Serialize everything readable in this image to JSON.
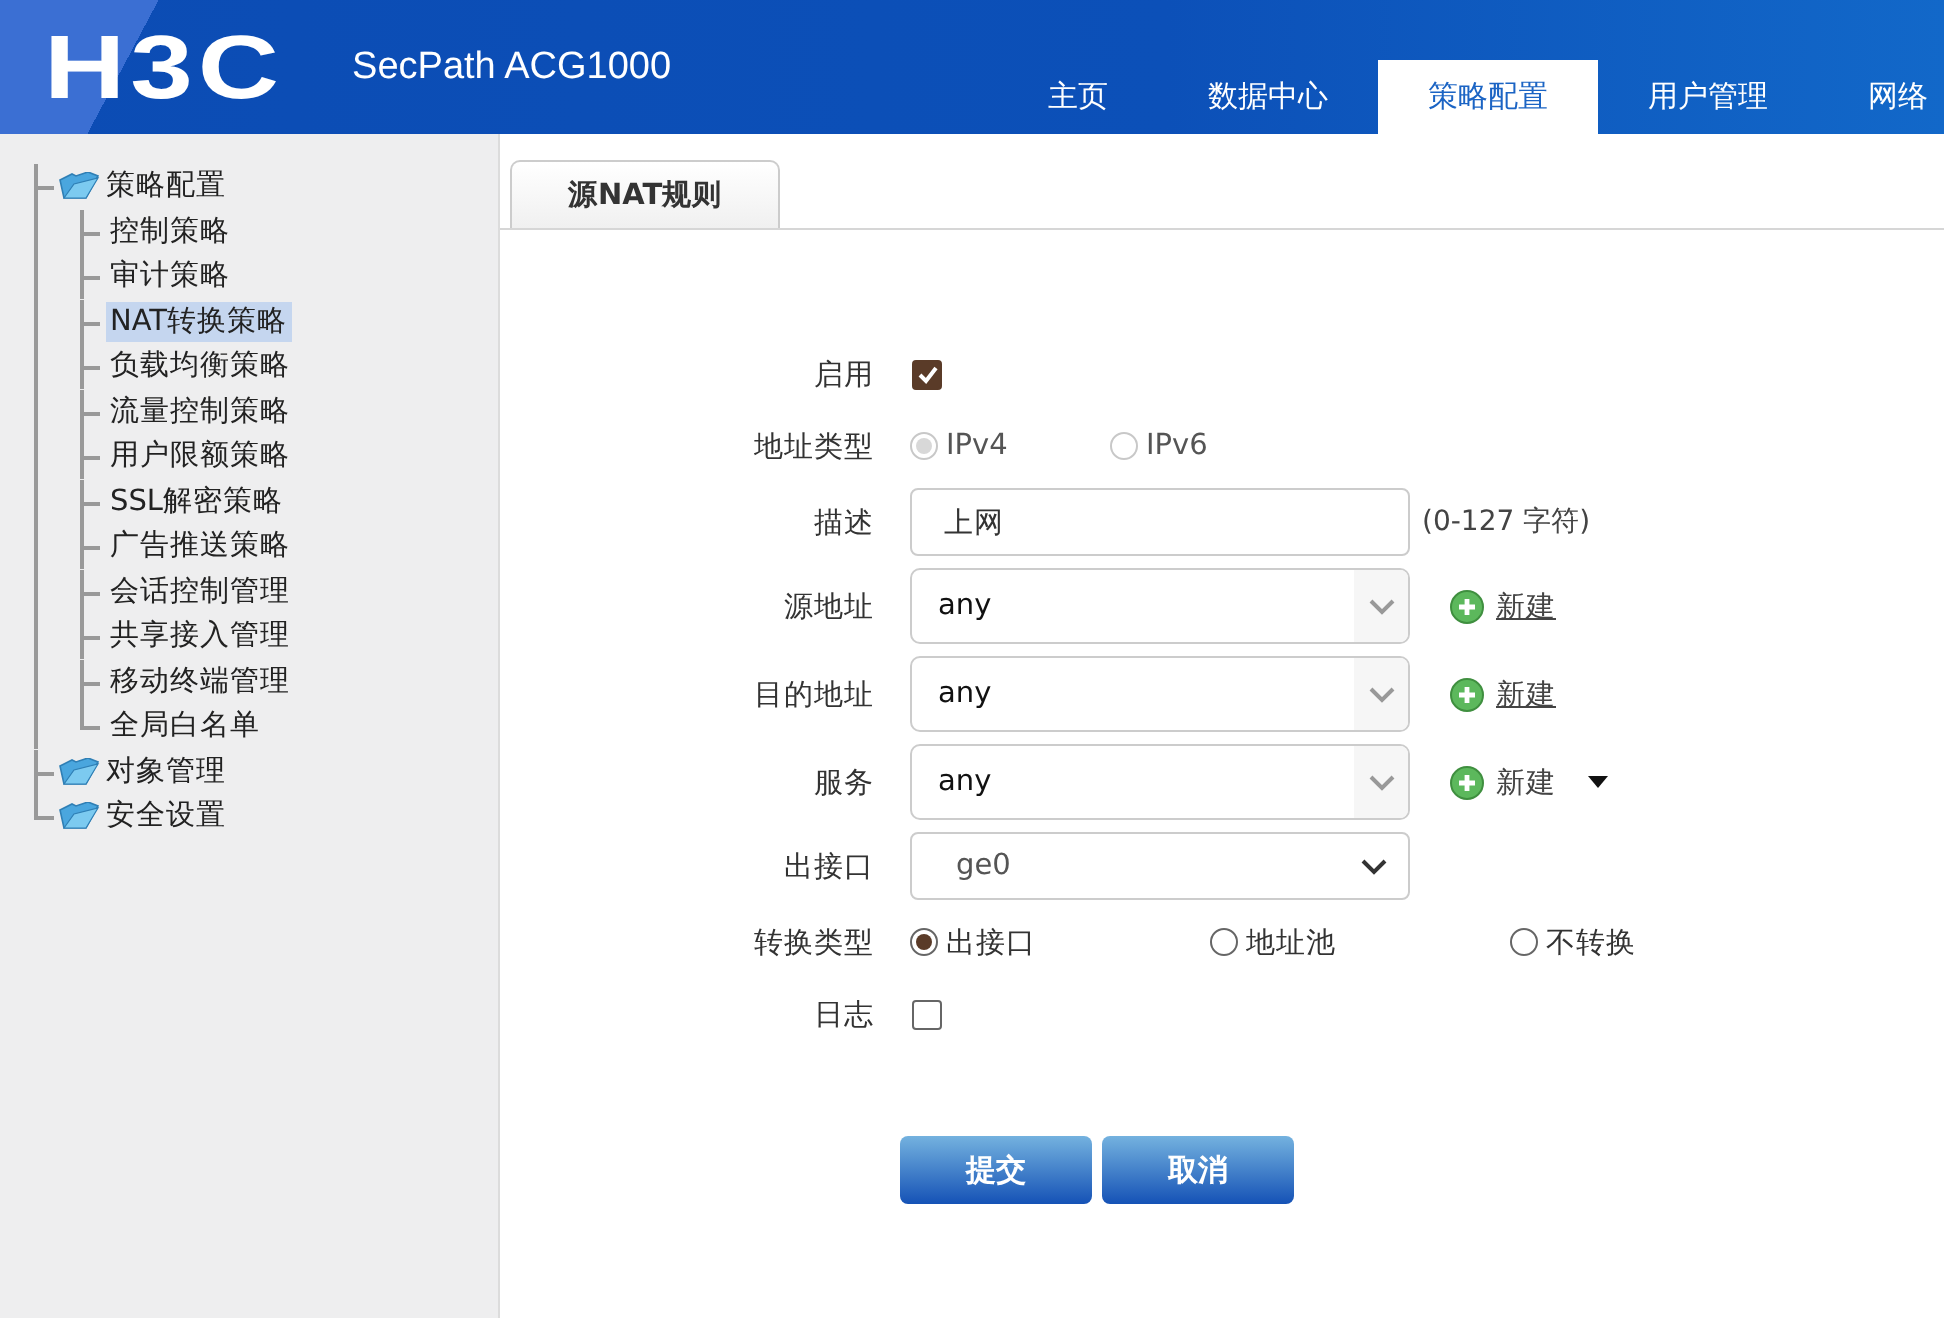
{
  "header": {
    "logo": "H3C",
    "product": "SecPath ACG1000",
    "nav": [
      {
        "label": "主页",
        "selected": false
      },
      {
        "label": "数据中心",
        "selected": false
      },
      {
        "label": "策略配置",
        "selected": true
      },
      {
        "label": "用户管理",
        "selected": false
      },
      {
        "label": "网络",
        "selected": false
      }
    ]
  },
  "sidebar": {
    "tree": [
      {
        "label": "策略配置",
        "selected": false,
        "children": [
          {
            "label": "控制策略",
            "selected": false
          },
          {
            "label": "审计策略",
            "selected": false
          },
          {
            "label": "NAT转换策略",
            "selected": true
          },
          {
            "label": "负载均衡策略",
            "selected": false
          },
          {
            "label": "流量控制策略",
            "selected": false
          },
          {
            "label": "用户限额策略",
            "selected": false
          },
          {
            "label": "SSL解密策略",
            "selected": false
          },
          {
            "label": "广告推送策略",
            "selected": false
          },
          {
            "label": "会话控制管理",
            "selected": false
          },
          {
            "label": "共享接入管理",
            "selected": false
          },
          {
            "label": "移动终端管理",
            "selected": false
          },
          {
            "label": "全局白名单",
            "selected": false
          }
        ]
      },
      {
        "label": "对象管理",
        "selected": false
      },
      {
        "label": "安全设置",
        "selected": false
      }
    ]
  },
  "content": {
    "tabs": [
      {
        "label": "源NAT规则",
        "selected": true
      }
    ],
    "form": {
      "rows": [
        {
          "kind": "checkbox",
          "label": "启用",
          "checked": true
        },
        {
          "kind": "radio",
          "label": "地址类型",
          "disabled": true,
          "options": [
            {
              "label": "IPv4",
              "selected": true
            },
            {
              "label": "IPv6",
              "selected": false
            }
          ]
        },
        {
          "kind": "text",
          "label": "描述",
          "value": "上网",
          "hint": "(0-127 字符)"
        },
        {
          "kind": "combo",
          "label": "源地址",
          "value": "any",
          "action": {
            "label": "新建",
            "link": true,
            "menu": false
          }
        },
        {
          "kind": "combo",
          "label": "目的地址",
          "value": "any",
          "action": {
            "label": "新建",
            "link": true,
            "menu": false
          }
        },
        {
          "kind": "combo",
          "label": "服务",
          "value": "any",
          "action": {
            "label": "新建",
            "link": false,
            "menu": true
          }
        },
        {
          "kind": "select",
          "label": "出接口",
          "value": "ge0"
        },
        {
          "kind": "radio",
          "label": "转换类型",
          "disabled": false,
          "options": [
            {
              "label": "出接口",
              "selected": true
            },
            {
              "label": "地址池",
              "selected": false
            },
            {
              "label": "不转换",
              "selected": false
            }
          ]
        },
        {
          "kind": "checkbox",
          "label": "日志",
          "checked": false
        }
      ]
    },
    "buttons": [
      "提交",
      "取消"
    ]
  }
}
